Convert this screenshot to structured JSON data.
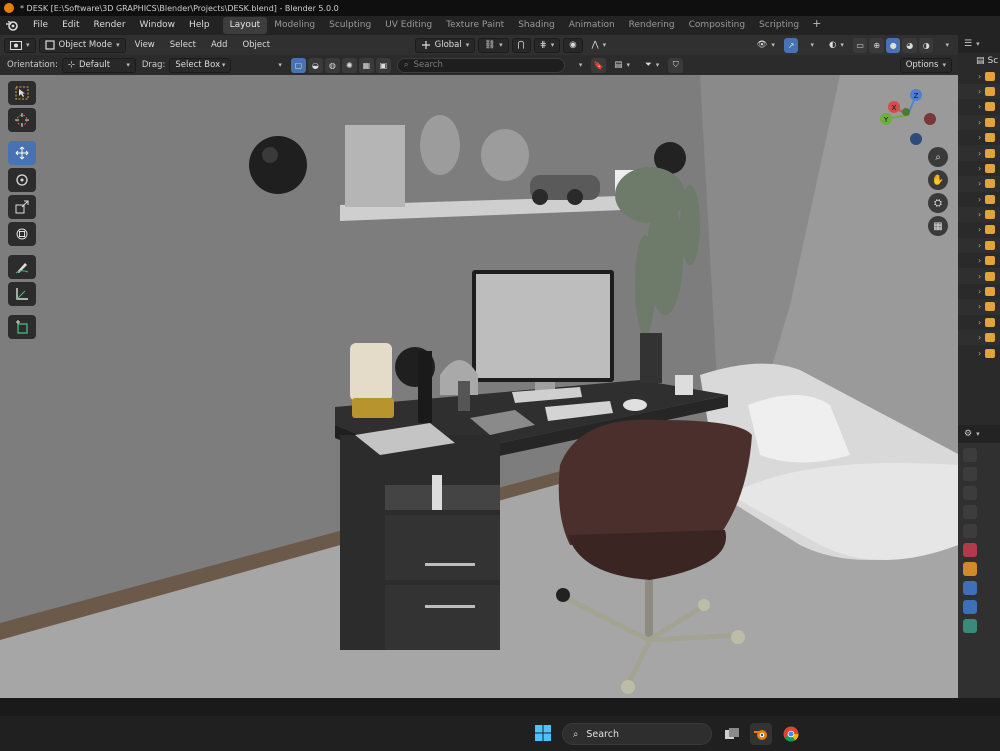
{
  "window": {
    "title": "* DESK [E:\\Software\\3D GRAPHICS\\Blender\\Projects\\DESK.blend] - Blender 5.0.0"
  },
  "menu": [
    "File",
    "Edit",
    "Render",
    "Window",
    "Help"
  ],
  "workspaces": {
    "tabs": [
      "Layout",
      "Modeling",
      "Sculpting",
      "UV Editing",
      "Texture Paint",
      "Shading",
      "Animation",
      "Rendering",
      "Compositing",
      "Scripting"
    ],
    "active": "Layout",
    "add_symbol": "+"
  },
  "header": {
    "mode": "Object Mode",
    "menus": [
      "View",
      "Select",
      "Add",
      "Object"
    ],
    "transform_orientation": "Global"
  },
  "tool_settings": {
    "orientation_label": "Orientation:",
    "orientation_value": "Default",
    "drag_label": "Drag:",
    "drag_value": "Select Box",
    "search_placeholder": "Search",
    "options_label": "Options"
  },
  "outliner": {
    "header": "Sc",
    "rows": 19
  },
  "taskbar": {
    "search_label": "Search"
  },
  "colors": {
    "accent": "#4772b3",
    "object_icon": "#e0a33e",
    "blender_orange": "#e87d0d"
  },
  "icons": {
    "tools": [
      "select-box-icon",
      "cursor-icon",
      "move-icon",
      "rotate-icon",
      "scale-icon",
      "transform-icon",
      "annotate-icon",
      "measure-icon",
      "add-cube-icon"
    ],
    "navigation": [
      "zoom-icon",
      "pan-hand-icon",
      "camera-view-icon",
      "ortho-grid-icon"
    ]
  }
}
